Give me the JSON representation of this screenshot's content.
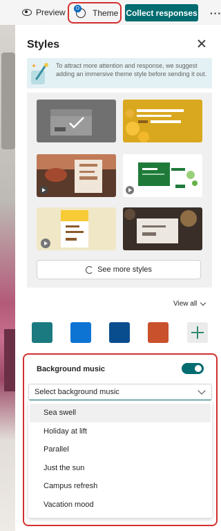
{
  "toolbar": {
    "preview_label": "Preview",
    "theme_label": "Theme",
    "theme_badge": "D",
    "collect_label": "Collect responses",
    "more_label": "···"
  },
  "panel": {
    "title": "Styles",
    "close_icon": "close-icon",
    "tip_text": "To attract more attention and response, we suggest adding an immersive theme style before sending it out.",
    "see_more_label": "See more styles",
    "view_all_label": "View all"
  },
  "style_thumbnails": [
    {
      "name": "gray-check",
      "accent": "#5c5c5c"
    },
    {
      "name": "yellow-emoji",
      "accent": "#d9a81f"
    },
    {
      "name": "dessert-photo",
      "accent": "#6b3b24"
    },
    {
      "name": "green-playful",
      "accent": "#1f7a3a"
    },
    {
      "name": "yellow-pattern",
      "accent": "#e8dfc0"
    },
    {
      "name": "dark-bokeh",
      "accent": "#3a2f28"
    }
  ],
  "color_swatches": [
    "#1b7a80",
    "#0e74d4",
    "#0a4d8f",
    "#c9512b"
  ],
  "music": {
    "label": "Background music",
    "enabled": true,
    "select_placeholder": "Select background music",
    "options": [
      "Sea swell",
      "Holiday at lift",
      "Parallel",
      "Just the sun",
      "Campus refresh",
      "Vacation mood"
    ],
    "hovered_option": "Sea swell"
  },
  "colors": {
    "accent": "#036c70",
    "highlight": "#d32f2f"
  }
}
